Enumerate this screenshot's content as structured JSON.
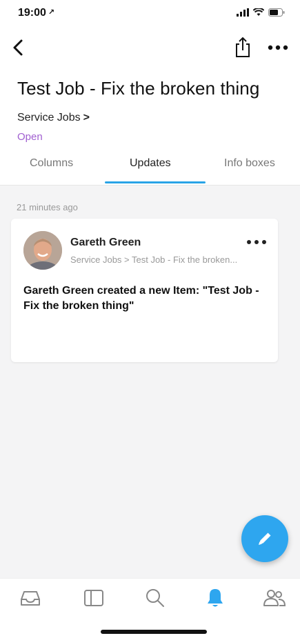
{
  "status_bar": {
    "time": "19:00",
    "location_glyph": "↗"
  },
  "nav": {
    "back_icon": "chevron-left-icon",
    "share_icon": "share-icon",
    "more_icon": "more-horizontal-icon"
  },
  "item": {
    "title": "Test Job - Fix the broken thing",
    "breadcrumb": "Service Jobs",
    "breadcrumb_chevron": ">",
    "status": "Open",
    "status_color": "#a05fd0"
  },
  "tabs": [
    {
      "label": "Columns",
      "active": false
    },
    {
      "label": "Updates",
      "active": true
    },
    {
      "label": "Info boxes",
      "active": false
    }
  ],
  "feed": {
    "time_ago": "21 minutes ago",
    "cards": [
      {
        "author": "Gareth Green",
        "path": "Service Jobs > Test Job - Fix the broken...",
        "body": "Gareth Green created a new Item: \"Test Job - Fix the broken thing\""
      }
    ]
  },
  "fab": {
    "icon": "pencil-icon",
    "color": "#2ea6ef"
  },
  "tabbar": {
    "items": [
      {
        "icon": "inbox-icon",
        "active": false
      },
      {
        "icon": "sidebar-panel-icon",
        "active": false
      },
      {
        "icon": "search-icon",
        "active": false
      },
      {
        "icon": "bell-icon",
        "active": true
      },
      {
        "icon": "people-icon",
        "active": false
      }
    ],
    "active_color": "#2ea6ef"
  }
}
